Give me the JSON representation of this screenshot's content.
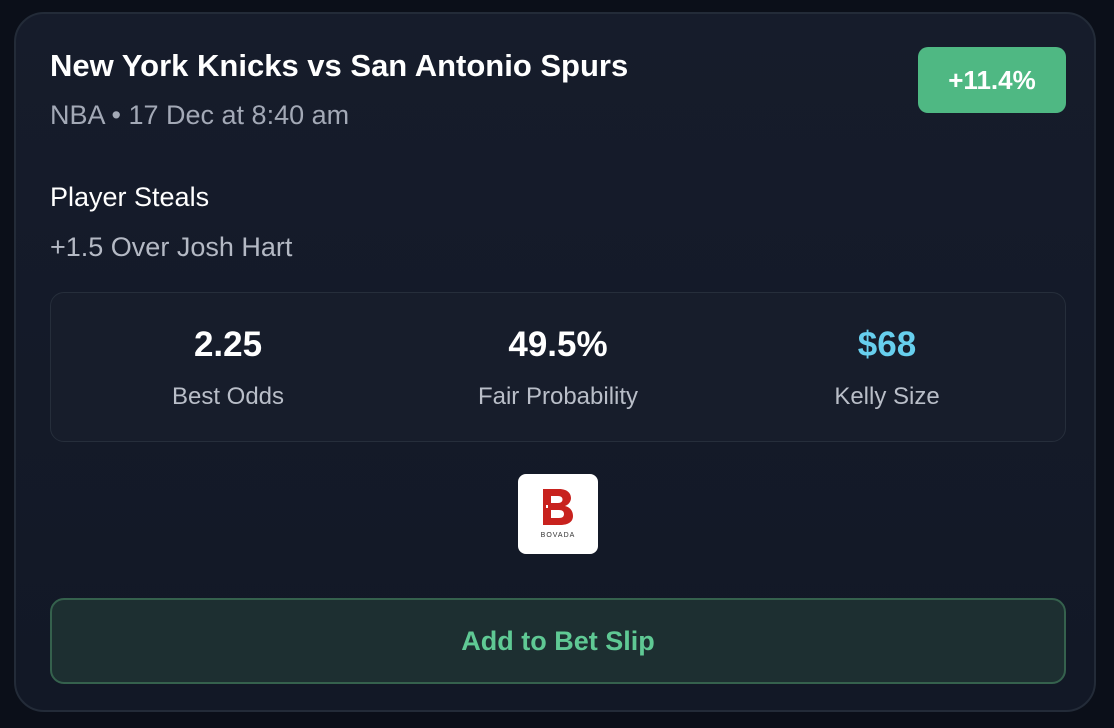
{
  "event": {
    "title": "New York Knicks vs San Antonio Spurs",
    "subtitle": "NBA • 17 Dec at 8:40 am",
    "edge": "+11.4%"
  },
  "bet": {
    "market": "Player Steals",
    "selection": "+1.5 Over Josh Hart"
  },
  "stats": [
    {
      "value": "2.25",
      "label": "Best Odds"
    },
    {
      "value": "49.5%",
      "label": "Fair Probability"
    },
    {
      "value": "$68",
      "label": "Kelly Size"
    }
  ],
  "sportsbook": {
    "name": "BOVADA",
    "icon": "bovada-logo-icon",
    "brand_color": "#c8221e"
  },
  "actions": {
    "add_label": "Add to Bet Slip"
  },
  "colors": {
    "background": "#0b0f19",
    "card": "#151b29",
    "edge_badge": "#4fb883",
    "kelly_value": "#67cfee",
    "button_text": "#5fc994"
  }
}
